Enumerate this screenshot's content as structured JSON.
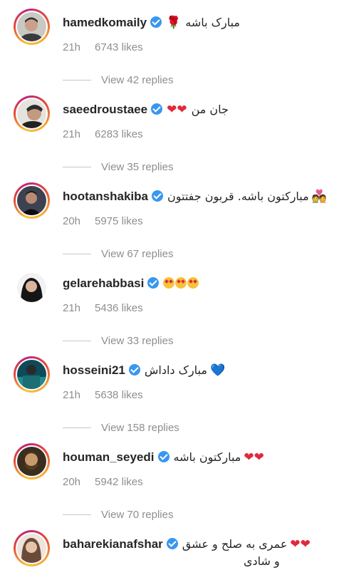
{
  "comments": [
    {
      "username": "hamedkomaily",
      "text": "مبارک باشه",
      "emoji": "🌹",
      "time": "21h",
      "likes": "6743 likes",
      "replies": "View 42 replies"
    },
    {
      "username": "saeedroustaee",
      "text": "جان من",
      "emoji": "❤❤",
      "time": "21h",
      "likes": "6283 likes",
      "replies": "View 35 replies"
    },
    {
      "username": "hootanshakiba",
      "text": "مبارکتون باشه. قربون جفتتون",
      "emoji": "💑",
      "time": "20h",
      "likes": "5975 likes",
      "replies": "View 67 replies"
    },
    {
      "username": "gelarehabbasi",
      "text": "",
      "emoji": "😍😍😍",
      "time": "21h",
      "likes": "5436 likes",
      "replies": "View 33 replies"
    },
    {
      "username": "hosseini21",
      "text": "مبارک داداش",
      "emoji": "💙",
      "time": "21h",
      "likes": "5638 likes",
      "replies": "View 158 replies"
    },
    {
      "username": "houman_seyedi",
      "text": "مبارکتون باشه",
      "emoji": "❤❤",
      "time": "20h",
      "likes": "5942 likes",
      "replies": "View 70 replies"
    },
    {
      "username": "baharekianafshar",
      "text": "عمری به صلح و عشق",
      "emoji": "❤❤",
      "text2": "و شادی",
      "time": "",
      "likes": "",
      "replies": ""
    }
  ],
  "colors": {
    "verified": "#3897f0",
    "secondary_text": "#8e8e8e",
    "heart": "#e02a3b"
  }
}
